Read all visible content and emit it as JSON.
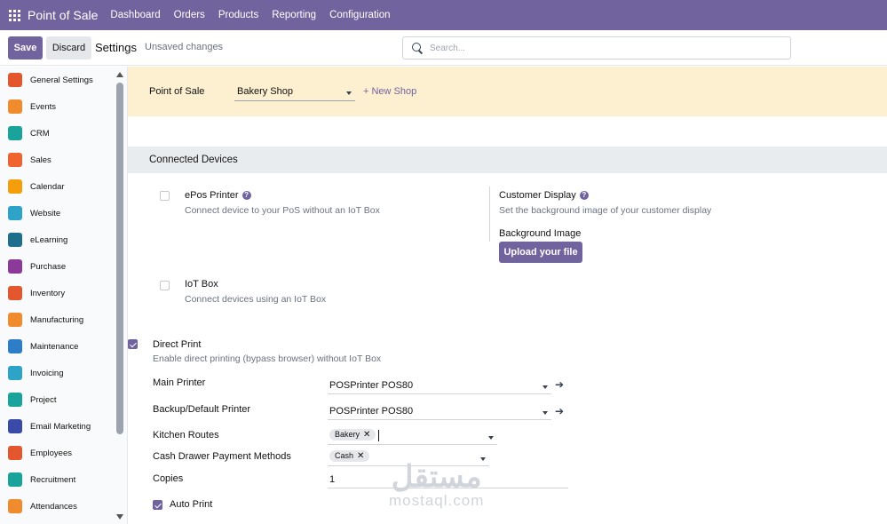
{
  "topnav": {
    "brand": "Point of Sale",
    "menus": [
      "Dashboard",
      "Orders",
      "Products",
      "Reporting",
      "Configuration"
    ]
  },
  "control_panel": {
    "save_label": "Save",
    "discard_label": "Discard",
    "title": "Settings",
    "status": "Unsaved changes",
    "search_placeholder": "Search..."
  },
  "sidebar": {
    "items": [
      {
        "label": "General Settings",
        "icon": "general-settings-icon",
        "color": "#e4572e"
      },
      {
        "label": "Events",
        "icon": "events-icon",
        "color": "#f08c2e"
      },
      {
        "label": "CRM",
        "icon": "crm-icon",
        "color": "#1aa39a"
      },
      {
        "label": "Sales",
        "icon": "sales-icon",
        "color": "#f0622e"
      },
      {
        "label": "Calendar",
        "icon": "calendar-icon",
        "color": "#f59e0b"
      },
      {
        "label": "Website",
        "icon": "website-icon",
        "color": "#2ea3c8"
      },
      {
        "label": "eLearning",
        "icon": "elearning-icon",
        "color": "#1e6f8c"
      },
      {
        "label": "Purchase",
        "icon": "purchase-icon",
        "color": "#8b3a9a"
      },
      {
        "label": "Inventory",
        "icon": "inventory-icon",
        "color": "#e4572e"
      },
      {
        "label": "Manufacturing",
        "icon": "manufacturing-icon",
        "color": "#f08c2e"
      },
      {
        "label": "Maintenance",
        "icon": "maintenance-icon",
        "color": "#2e7dc8"
      },
      {
        "label": "Invoicing",
        "icon": "invoicing-icon",
        "color": "#2ea3c8"
      },
      {
        "label": "Project",
        "icon": "project-icon",
        "color": "#1aa39a"
      },
      {
        "label": "Email Marketing",
        "icon": "email-marketing-icon",
        "color": "#3b4aa8"
      },
      {
        "label": "Employees",
        "icon": "employees-icon",
        "color": "#e4572e"
      },
      {
        "label": "Recruitment",
        "icon": "recruitment-icon",
        "color": "#1aa39a"
      },
      {
        "label": "Attendances",
        "icon": "attendances-icon",
        "color": "#f08c2e"
      }
    ]
  },
  "banner": {
    "label": "Point of Sale",
    "shop": "Bakery Shop",
    "new_shop": "+ New Shop"
  },
  "connected_devices": {
    "title": "Connected Devices",
    "epos": {
      "title": "ePos Printer",
      "desc": "Connect device to your PoS without an IoT Box",
      "checked": false
    },
    "customer_display": {
      "title": "Customer Display",
      "desc": "Set the background image of your customer display",
      "bg_label": "Background Image",
      "upload_label": "Upload your file"
    },
    "iot": {
      "title": "IoT Box",
      "desc": "Connect devices using an IoT Box",
      "checked": false
    },
    "direct_print": {
      "title": "Direct Print",
      "desc": "Enable direct printing (bypass browser) without IoT Box",
      "checked": true
    },
    "main_printer": {
      "label": "Main Printer",
      "value": "POSPrinter POS80"
    },
    "backup_printer": {
      "label": "Backup/Default Printer",
      "value": "POSPrinter POS80"
    },
    "kitchen_routes": {
      "label": "Kitchen Routes",
      "tag": "Bakery"
    },
    "cash_drawer": {
      "label": "Cash Drawer Payment Methods",
      "tag": "Cash"
    },
    "copies": {
      "label": "Copies",
      "value": "1"
    },
    "auto_print": {
      "label": "Auto Print",
      "checked": true
    }
  },
  "watermark": {
    "arabic": "مستقل",
    "latin": "mostaql.com"
  }
}
